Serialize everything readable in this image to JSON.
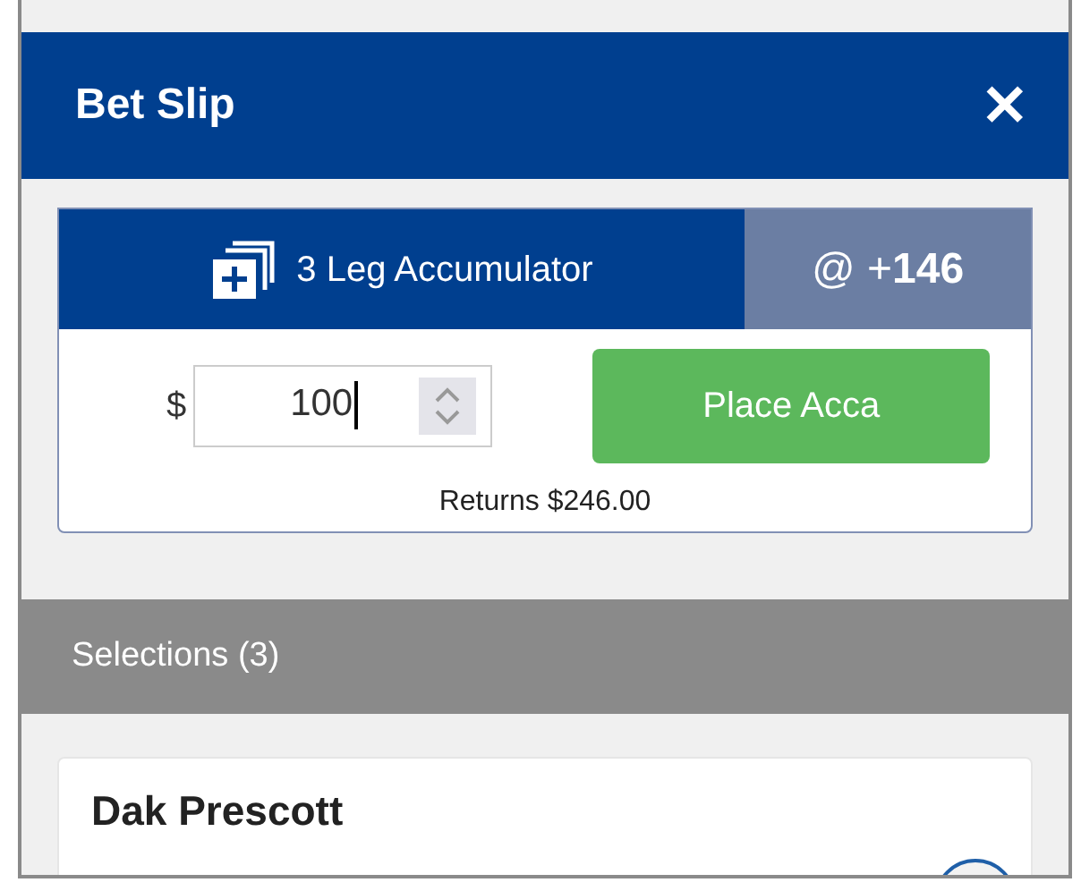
{
  "header": {
    "title": "Bet Slip",
    "close": "✕"
  },
  "accumulator": {
    "label": "3 Leg Accumulator",
    "odds_prefix": "@ +",
    "odds": "146",
    "currency": "$",
    "stake": "100",
    "button": "Place Acca",
    "returns": "Returns $246.00"
  },
  "selections": {
    "title": "Selections (3)",
    "items": [
      {
        "name": "Dak Prescott",
        "selected": false
      }
    ]
  }
}
